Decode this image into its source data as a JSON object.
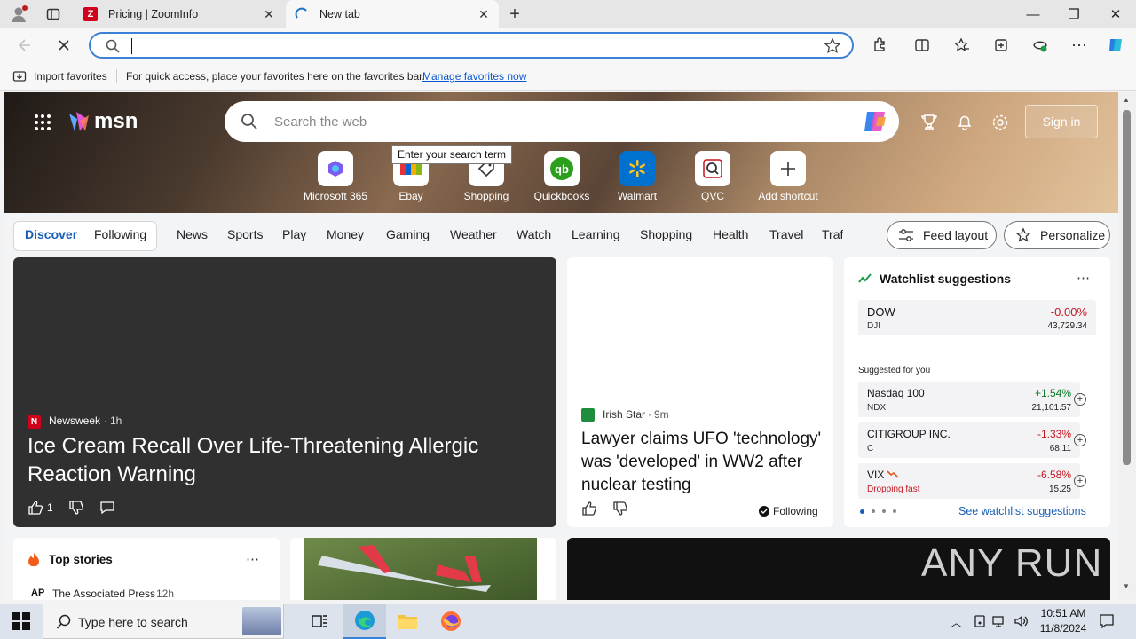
{
  "tabs": [
    {
      "title": "Pricing | ZoomInfo",
      "favicon": "zoominfo-icon",
      "active": false
    },
    {
      "title": "New tab",
      "favicon": "loading-spinner-icon",
      "active": true
    }
  ],
  "toolbar": {
    "address_value": "",
    "favorites_star": "star-icon"
  },
  "favbar": {
    "import_label": "Import favorites",
    "hint": "For quick access, place your favorites here on the favorites bar.",
    "manage_link": "Manage favorites now"
  },
  "msn": {
    "logo": "msn",
    "search_placeholder": "Search the web",
    "tooltip": "Enter your search term",
    "signin": "Sign in",
    "shortcuts": [
      {
        "label": "Microsoft 365",
        "icon": "m365-icon"
      },
      {
        "label": "Ebay",
        "icon": "ebay-icon"
      },
      {
        "label": "Shopping",
        "icon": "shopping-tag-icon"
      },
      {
        "label": "Quickbooks",
        "icon": "quickbooks-icon"
      },
      {
        "label": "Walmart",
        "icon": "walmart-icon"
      },
      {
        "label": "QVC",
        "icon": "qvc-icon"
      },
      {
        "label": "Add shortcut",
        "icon": "plus-icon"
      }
    ],
    "nav": {
      "discover": "Discover",
      "following": "Following",
      "items": [
        "News",
        "Sports",
        "Play",
        "Money",
        "Gaming",
        "Weather",
        "Watch",
        "Learning",
        "Shopping",
        "Health",
        "Travel",
        "Traf"
      ],
      "feed_layout": "Feed layout",
      "personalize": "Personalize"
    },
    "hero_card": {
      "source": "Newsweek",
      "age": "1h",
      "title": "Ice Cream Recall Over Life-Threatening Allergic Reaction Warning",
      "likes": "1"
    },
    "story_card": {
      "source": "Irish Star",
      "age": "9m",
      "title": "Lawyer claims UFO 'technology' was 'developed' in WW2 after nuclear testing",
      "following": "Following"
    },
    "watchlist": {
      "title": "Watchlist suggestions",
      "main": {
        "name": "DOW",
        "symbol": "DJI",
        "change": "-0.00%",
        "value": "43,729.34"
      },
      "suggested_label": "Suggested for you",
      "items": [
        {
          "name": "Nasdaq 100",
          "symbol": "NDX",
          "change": "+1.54%",
          "value": "21,101.57",
          "color": "#0b7a28"
        },
        {
          "name": "CITIGROUP INC.",
          "symbol": "C",
          "change": "-1.33%",
          "value": "68.11",
          "color": "#c4161c"
        },
        {
          "name": "VIX",
          "symbol": "Dropping fast",
          "change": "-6.58%",
          "value": "15.25",
          "color": "#c4161c"
        }
      ],
      "see_link": "See watchlist suggestions"
    },
    "top_stories": {
      "title": "Top stories",
      "source": "The Associated Press",
      "age": "12h"
    }
  },
  "watermark": "ANY RUN",
  "taskbar": {
    "search_placeholder": "Type here to search",
    "time": "10:51 AM",
    "date": "11/8/2024"
  }
}
